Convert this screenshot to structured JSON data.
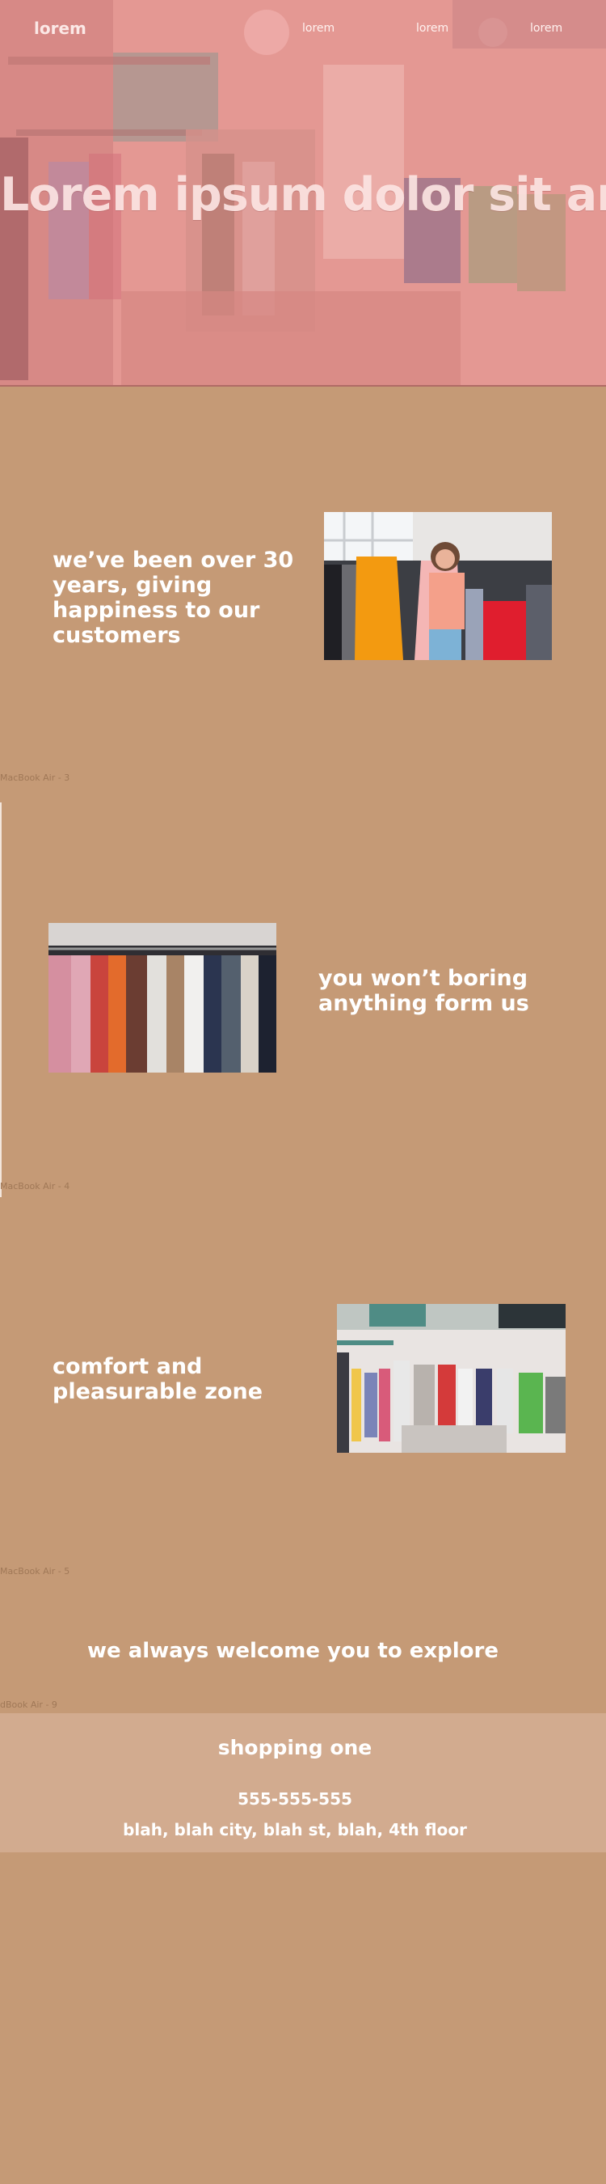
{
  "nav": {
    "logo": "lorem",
    "links": [
      "lorem",
      "lorem",
      "lorem"
    ]
  },
  "hero": {
    "title": "Lorem ipsum dolor sit amet"
  },
  "frames": [
    "MacBook Air - 3",
    "MacBook Air - 4",
    "MacBook Air - 5",
    "dBook Air - 9"
  ],
  "sections": [
    {
      "text": "we’ve been over 30 years, giving happiness to our customers"
    },
    {
      "text": "you won’t boring anything form us"
    },
    {
      "text": "comfort and pleasurable zone"
    }
  ],
  "welcome": "we always welcome you to explore",
  "footer": {
    "store_name": "shopping one",
    "phone": "555-555-555",
    "address": "blah, blah city, blah st, blah, 4th floor"
  },
  "colors": {
    "page_bg": "#c59a76",
    "footer_bg": "#d2ab8f",
    "hero_tint": "#e89a95"
  }
}
